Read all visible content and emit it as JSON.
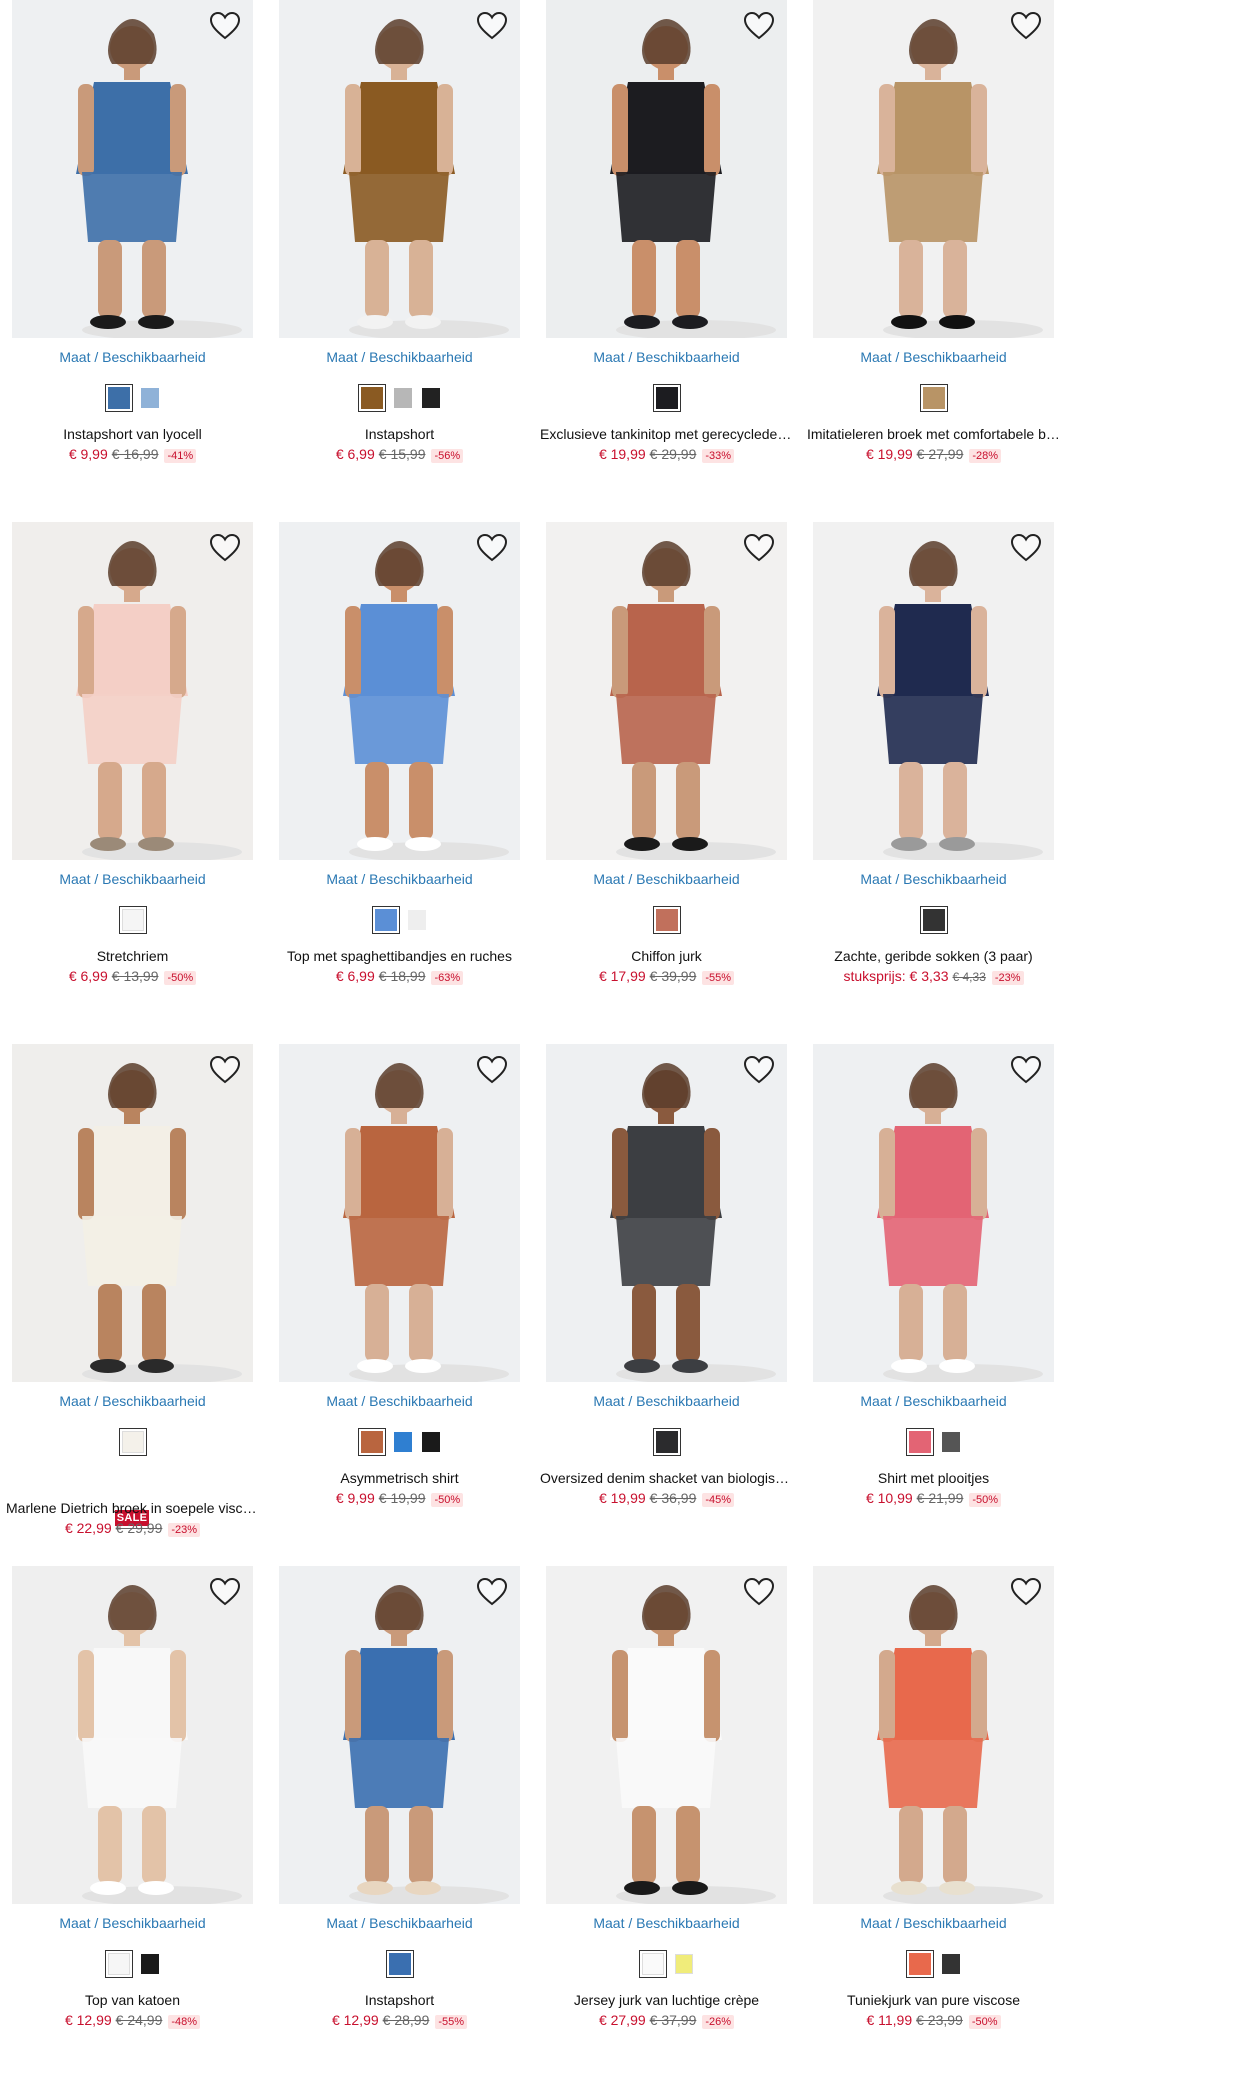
{
  "products": [
    {
      "maat": "Maat / Beschikbaarheid",
      "name": "Instapshort van lyocell",
      "price": "€ 9,99",
      "old": "€ 16,99",
      "disc": "-41%",
      "bg": "#eef0f2",
      "garment": "#3d6fa8",
      "skin": "#c99a7a",
      "shoe": "#1a1a1a",
      "swatches": [
        "#3d6fa8",
        "#8fb2d8"
      ]
    },
    {
      "maat": "Maat / Beschikbaarheid",
      "name": "Instapshort",
      "price": "€ 6,99",
      "old": "€ 15,99",
      "disc": "-56%",
      "bg": "#eef0f2",
      "garment": "#8a5a22",
      "skin": "#d8b296",
      "shoe": "#f2f2f2",
      "swatches": [
        "#8a5a22",
        "#b7b7b7",
        "#222222"
      ]
    },
    {
      "maat": "Maat / Beschikbaarheid",
      "name": "Exclusieve tankinitop met gerecyclede materialen",
      "price": "€ 19,99",
      "old": "€ 29,99",
      "disc": "-33%",
      "bg": "#eceeef",
      "garment": "#1c1c20",
      "skin": "#c98f6a",
      "shoe": "#1c1c20",
      "swatches": [
        "#1c1c20"
      ]
    },
    {
      "maat": "Maat / Beschikbaarheid",
      "name": "Imitatieleren broek met comfortabele band",
      "price": "€ 19,99",
      "old": "€ 27,99",
      "disc": "-28%",
      "bg": "#f1f1f1",
      "garment": "#b89466",
      "skin": "#d9b39a",
      "shoe": "#111111",
      "swatches": [
        "#b89466"
      ]
    },
    {
      "maat": "Maat / Beschikbaarheid",
      "name": "Stretchriem",
      "price": "€ 6,99",
      "old": "€ 13,99",
      "disc": "-50%",
      "bg": "#f0eeec",
      "garment": "#f4cfc6",
      "skin": "#d6a98c",
      "shoe": "#9b8a78",
      "swatches": [
        "#f5f5f5"
      ]
    },
    {
      "maat": "Maat / Beschikbaarheid",
      "name": "Top met spaghettibandjes en ruches",
      "price": "€ 6,99",
      "old": "€ 18,99",
      "disc": "-63%",
      "bg": "#eef0f2",
      "garment": "#5b8fd6",
      "skin": "#c98f6a",
      "shoe": "#ffffff",
      "swatches": [
        "#5b8fd6",
        "#eeeeee"
      ]
    },
    {
      "maat": "Maat / Beschikbaarheid",
      "name": "Chiffon jurk",
      "price": "€ 17,99",
      "old": "€ 39,99",
      "disc": "-55%",
      "bg": "#f2f1f0",
      "garment": "#b8644c",
      "skin": "#c99a7a",
      "shoe": "#1a1a1a",
      "swatches": [
        "#c1705c"
      ]
    },
    {
      "maat": "Maat / Beschikbaarheid",
      "name": "Zachte, geribde sokken (3 paar)",
      "price": "stuksprijs: € 3,33",
      "old": "€ 4,33",
      "disc": "-23%",
      "unit": true,
      "bg": "#f1f1f1",
      "garment": "#1f2a4f",
      "skin": "#dab39b",
      "shoe": "#9a9a9a",
      "swatches": [
        "#333333"
      ]
    },
    {
      "maat": "Maat / Beschikbaarheid",
      "name": "Marlene Dietrich broek in soepele viscose",
      "price": "€ 22,99",
      "old": "€ 29,99",
      "disc": "-23%",
      "sale": "SALE",
      "bg": "#efeeec",
      "garment": "#f3efe6",
      "skin": "#b9845f",
      "shoe": "#2a2a2a",
      "swatches": [
        "#f4f1ea"
      ]
    },
    {
      "maat": "Maat / Beschikbaarheid",
      "name": "Asymmetrisch shirt",
      "price": "€ 9,99",
      "old": "€ 19,99",
      "disc": "-50%",
      "bg": "#eef0f2",
      "garment": "#b9653f",
      "skin": "#d7b096",
      "shoe": "#ffffff",
      "swatches": [
        "#b9653f",
        "#2f7fd1",
        "#1a1a1a"
      ]
    },
    {
      "maat": "Maat / Beschikbaarheid",
      "name": "Oversized denim shacket van biologisch katoen",
      "price": "€ 19,99",
      "old": "€ 36,99",
      "disc": "-45%",
      "bg": "#eef0f2",
      "garment": "#3c3e42",
      "skin": "#8a5a3e",
      "shoe": "#3c3e42",
      "swatches": [
        "#2b2b2d"
      ]
    },
    {
      "maat": "Maat / Beschikbaarheid",
      "name": "Shirt met plooitjes",
      "price": "€ 10,99",
      "old": "€ 21,99",
      "disc": "-50%",
      "bg": "#eef0f2",
      "garment": "#e36474",
      "skin": "#d7b096",
      "shoe": "#ffffff",
      "swatches": [
        "#e36474",
        "#555555"
      ]
    },
    {
      "maat": "Maat / Beschikbaarheid",
      "name": "Top van katoen",
      "price": "€ 12,99",
      "old": "€ 24,99",
      "disc": "-48%",
      "bg": "#efefef",
      "garment": "#f8f8f8",
      "skin": "#e3c3a8",
      "shoe": "#ffffff",
      "swatches": [
        "#f6f6f6",
        "#1a1a1a"
      ]
    },
    {
      "maat": "Maat / Beschikbaarheid",
      "name": "Instapshort",
      "price": "€ 12,99",
      "old": "€ 28,99",
      "disc": "-55%",
      "bg": "#eef0f2",
      "garment": "#3a6fb0",
      "skin": "#c99a7a",
      "shoe": "#e8d6c0",
      "swatches": [
        "#3a6fb0"
      ]
    },
    {
      "maat": "Maat / Beschikbaarheid",
      "name": "Jersey jurk van luchtige crèpe",
      "price": "€ 27,99",
      "old": "€ 37,99",
      "disc": "-26%",
      "bg": "#f1f1f1",
      "garment": "#fafafa",
      "skin": "#c6936f",
      "shoe": "#1a1a1a",
      "swatches": [
        "#fafafa",
        "#f0ec7a"
      ]
    },
    {
      "maat": "Maat / Beschikbaarheid",
      "name": "Tuniekjurk van pure viscose",
      "price": "€ 11,99",
      "old": "€ 23,99",
      "disc": "-50%",
      "bg": "#f1f1f1",
      "garment": "#e8694c",
      "skin": "#d3a98d",
      "shoe": "#e8e0cf",
      "swatches": [
        "#e8694c",
        "#333333"
      ]
    }
  ]
}
